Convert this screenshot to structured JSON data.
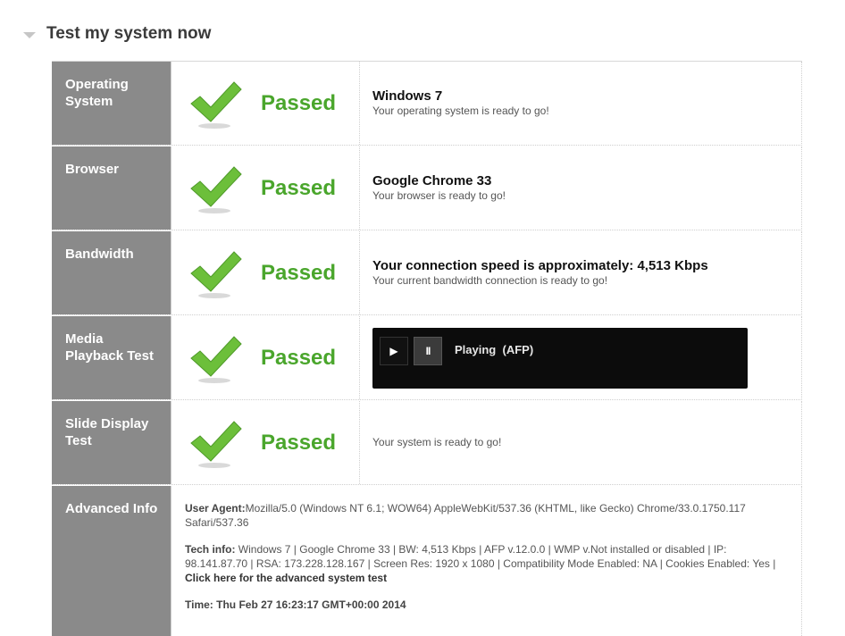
{
  "section": {
    "title": "Test my system now"
  },
  "status_text": "Passed",
  "rows": [
    {
      "label": "Operating System",
      "title": "Windows 7",
      "subtitle": "Your operating system is ready to go!"
    },
    {
      "label": "Browser",
      "title": "Google Chrome 33",
      "subtitle": "Your browser is ready to go!"
    },
    {
      "label": "Bandwidth",
      "title": "Your connection speed is approximately: 4,513 Kbps",
      "subtitle": "Your current bandwidth connection is ready to go!"
    },
    {
      "label": "Media Playback Test",
      "player": {
        "status": "Playing",
        "format": "(AFP)"
      }
    },
    {
      "label": "Slide Display Test",
      "subtitle": "Your system is ready to go!"
    }
  ],
  "advanced": {
    "label": "Advanced Info",
    "user_agent_label": "User Agent:",
    "user_agent": "Mozilla/5.0 (Windows NT 6.1; WOW64) AppleWebKit/537.36 (KHTML, like Gecko) Chrome/33.0.1750.117 Safari/537.36",
    "tech_label": "Tech info:",
    "tech_info": " Windows 7 | Google Chrome 33 | BW: 4,513 Kbps | AFP v.12.0.0 | WMP v.Not installed or disabled | IP: 98.141.87.70 | RSA: 173.228.128.167 | Screen Res: 1920 x 1080 | Compatibility Mode Enabled: NA | Cookies Enabled: Yes | ",
    "advanced_link": "Click here for the advanced system test",
    "time_label": "Time:",
    "time": " Thu Feb 27 16:23:17 GMT+00:00 2014"
  },
  "colors": {
    "passed": "#4aa62c",
    "label_bg": "#8a8a8a",
    "check": "#6cbf3a"
  }
}
